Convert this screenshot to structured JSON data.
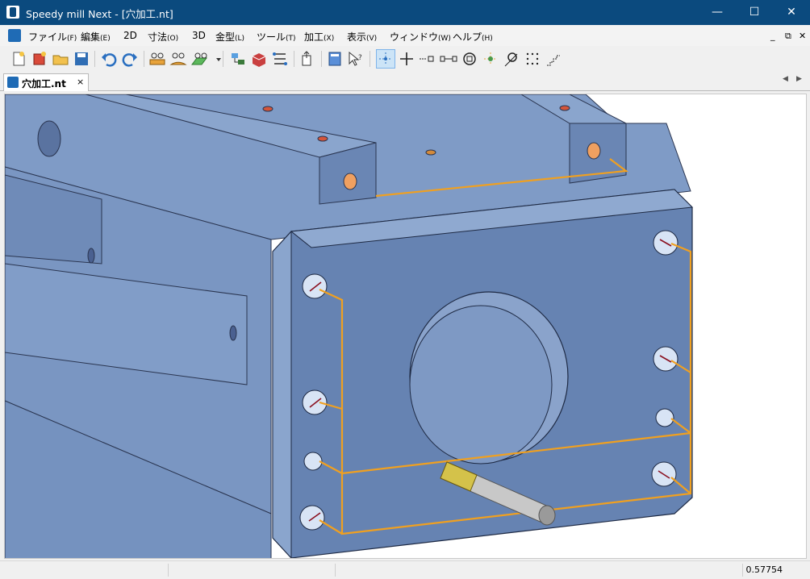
{
  "window": {
    "title": "Speedy mill Next - [穴加工.nt]"
  },
  "menu": {
    "items": [
      {
        "label": "ファイル",
        "key": "(F)"
      },
      {
        "label": "編集",
        "key": "(E)"
      },
      {
        "label": "2D",
        "key": ""
      },
      {
        "label": "寸法",
        "key": "(O)"
      },
      {
        "label": "3D",
        "key": ""
      },
      {
        "label": "金型",
        "key": "(L)"
      },
      {
        "label": "ツール",
        "key": "(T)"
      },
      {
        "label": "加工",
        "key": "(X)"
      },
      {
        "label": "表示",
        "key": "(V)"
      },
      {
        "label": "ウィンドウ",
        "key": "(W)"
      },
      {
        "label": "ヘルプ",
        "key": "(H)"
      }
    ]
  },
  "tabs": [
    {
      "label": "穴加工.nt",
      "close": "×"
    }
  ],
  "status": {
    "value": "0.57754"
  },
  "colors": {
    "titlebar": "#0b4a7e",
    "part": "#7f9bc6",
    "toolpath": "#f0a020",
    "tool_tip": "#d4c24a",
    "tool_body": "#c8c8c8"
  },
  "icons": [
    "new-file-icon",
    "new-part-icon",
    "open-folder-icon",
    "save-icon",
    "undo-icon",
    "redo-icon",
    "measure-icon",
    "angle-measure-icon",
    "dimension-icon",
    "layer-icon",
    "solid-icon",
    "path-icon",
    "export-icon",
    "calculator-icon",
    "help-pointer-icon",
    "select-point-icon",
    "crosshair-icon",
    "line-point-icon",
    "segment-icon",
    "circle-center-icon",
    "node-icon",
    "tangent-icon",
    "grid-snap-icon",
    "stairs-icon"
  ]
}
